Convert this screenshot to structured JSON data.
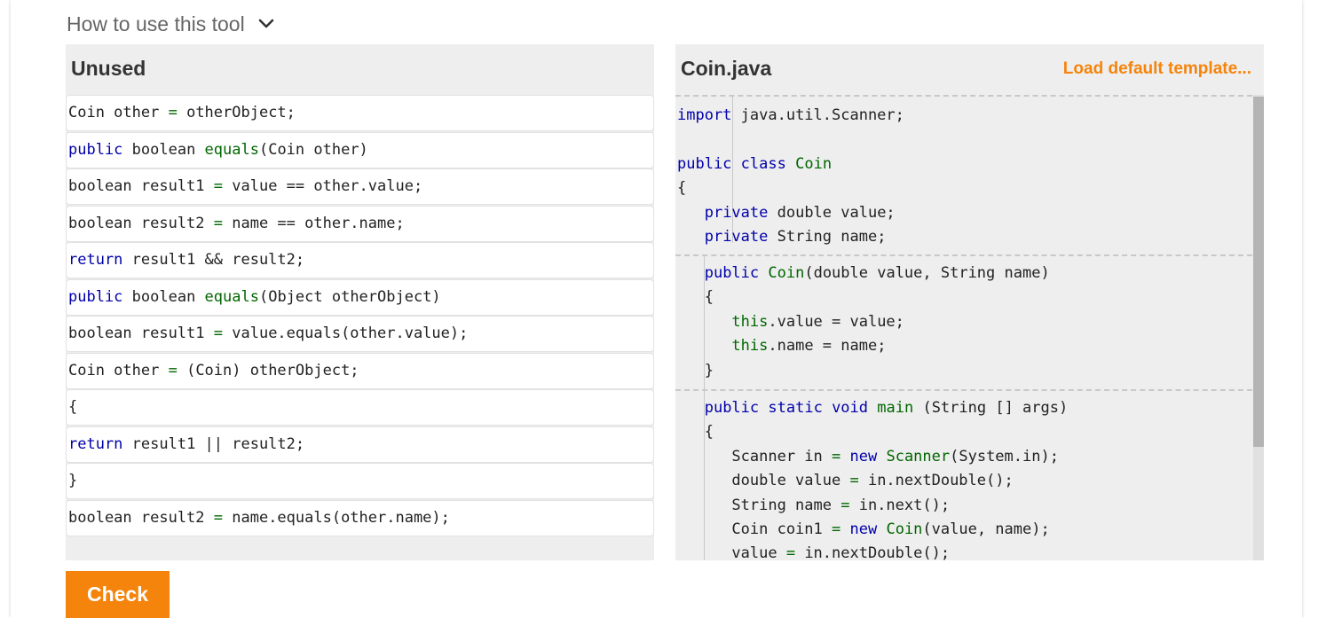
{
  "howto": {
    "label": "How to use this tool"
  },
  "unused_panel": {
    "title": "Unused",
    "tiles": [
      {
        "tokens": [
          {
            "t": "Coin other "
          },
          {
            "t": "=",
            "c": "op"
          },
          {
            "t": " otherObject;"
          }
        ]
      },
      {
        "tokens": [
          {
            "t": "public",
            "c": "kw"
          },
          {
            "t": " boolean "
          },
          {
            "t": "equals",
            "c": "fn"
          },
          {
            "t": "(Coin other)"
          }
        ]
      },
      {
        "tokens": [
          {
            "t": "boolean result1 "
          },
          {
            "t": "=",
            "c": "op"
          },
          {
            "t": " value == other.value;"
          }
        ]
      },
      {
        "tokens": [
          {
            "t": "boolean result2 "
          },
          {
            "t": "=",
            "c": "op"
          },
          {
            "t": " name == other.name;"
          }
        ]
      },
      {
        "tokens": [
          {
            "t": "return",
            "c": "kw"
          },
          {
            "t": " result1 && result2;"
          }
        ]
      },
      {
        "tokens": [
          {
            "t": "public",
            "c": "kw"
          },
          {
            "t": " boolean "
          },
          {
            "t": "equals",
            "c": "fn"
          },
          {
            "t": "(Object otherObject)"
          }
        ]
      },
      {
        "tokens": [
          {
            "t": "boolean result1 "
          },
          {
            "t": "=",
            "c": "op"
          },
          {
            "t": " value.equals(other.value);"
          }
        ]
      },
      {
        "tokens": [
          {
            "t": "Coin other "
          },
          {
            "t": "=",
            "c": "op"
          },
          {
            "t": " (Coin) otherObject;"
          }
        ]
      },
      {
        "tokens": [
          {
            "t": "{"
          }
        ]
      },
      {
        "tokens": [
          {
            "t": "return",
            "c": "kw"
          },
          {
            "t": " result1 || result2;"
          }
        ]
      },
      {
        "tokens": [
          {
            "t": "}"
          }
        ]
      },
      {
        "tokens": [
          {
            "t": "boolean result2 "
          },
          {
            "t": "=",
            "c": "op"
          },
          {
            "t": " name.equals(other.name);"
          }
        ]
      }
    ]
  },
  "editor_panel": {
    "title": "Coin.java",
    "load_link": "Load default template...",
    "blocks": [
      {
        "lines": [
          {
            "tokens": [
              {
                "t": "import",
                "c": "kw"
              },
              {
                "t": " java.util.Scanner;"
              }
            ]
          },
          {
            "tokens": [
              {
                "t": ""
              }
            ]
          },
          {
            "tokens": [
              {
                "t": "public",
                "c": "kw"
              },
              {
                "t": " "
              },
              {
                "t": "class",
                "c": "kw"
              },
              {
                "t": " "
              },
              {
                "t": "Coin",
                "c": "fn"
              }
            ]
          },
          {
            "tokens": [
              {
                "t": "{"
              }
            ]
          },
          {
            "tokens": [
              {
                "t": "   "
              },
              {
                "t": "private",
                "c": "kw"
              },
              {
                "t": " double value;"
              }
            ]
          },
          {
            "tokens": [
              {
                "t": "   "
              },
              {
                "t": "private",
                "c": "kw"
              },
              {
                "t": " String name;"
              }
            ]
          }
        ]
      },
      {
        "lines": [
          {
            "tokens": [
              {
                "t": "   "
              },
              {
                "t": "public",
                "c": "kw"
              },
              {
                "t": " "
              },
              {
                "t": "Coin",
                "c": "fn"
              },
              {
                "t": "(double value, String name)"
              }
            ]
          },
          {
            "tokens": [
              {
                "t": "   {"
              }
            ]
          },
          {
            "tokens": [
              {
                "t": "      "
              },
              {
                "t": "this",
                "c": "fn"
              },
              {
                "t": ".value = value;"
              }
            ]
          },
          {
            "tokens": [
              {
                "t": "      "
              },
              {
                "t": "this",
                "c": "fn"
              },
              {
                "t": ".name = name;"
              }
            ]
          },
          {
            "tokens": [
              {
                "t": "   }"
              }
            ]
          }
        ]
      },
      {
        "lines": [
          {
            "tokens": [
              {
                "t": "   "
              },
              {
                "t": "public",
                "c": "kw"
              },
              {
                "t": " "
              },
              {
                "t": "static",
                "c": "kw"
              },
              {
                "t": " "
              },
              {
                "t": "void",
                "c": "kw"
              },
              {
                "t": " "
              },
              {
                "t": "main",
                "c": "fn"
              },
              {
                "t": " (String [] args)"
              }
            ]
          },
          {
            "tokens": [
              {
                "t": "   {"
              }
            ]
          },
          {
            "tokens": [
              {
                "t": "      Scanner in "
              },
              {
                "t": "=",
                "c": "op"
              },
              {
                "t": " "
              },
              {
                "t": "new",
                "c": "kw"
              },
              {
                "t": " "
              },
              {
                "t": "Scanner",
                "c": "fn"
              },
              {
                "t": "(System.in);"
              }
            ]
          },
          {
            "tokens": [
              {
                "t": "      double value "
              },
              {
                "t": "=",
                "c": "op"
              },
              {
                "t": " in.nextDouble();"
              }
            ]
          },
          {
            "tokens": [
              {
                "t": "      String name "
              },
              {
                "t": "=",
                "c": "op"
              },
              {
                "t": " in.next();"
              }
            ]
          },
          {
            "tokens": [
              {
                "t": "      Coin coin1 "
              },
              {
                "t": "=",
                "c": "op"
              },
              {
                "t": " "
              },
              {
                "t": "new",
                "c": "kw"
              },
              {
                "t": " "
              },
              {
                "t": "Coin",
                "c": "fn"
              },
              {
                "t": "(value, name);"
              }
            ]
          },
          {
            "tokens": [
              {
                "t": "      value "
              },
              {
                "t": "=",
                "c": "op"
              },
              {
                "t": " in.nextDouble();"
              }
            ]
          }
        ]
      }
    ]
  },
  "check_button": {
    "label": "Check"
  },
  "colors": {
    "accent": "#f5840c",
    "keyword": "#0000aa",
    "identifier": "#006600"
  }
}
